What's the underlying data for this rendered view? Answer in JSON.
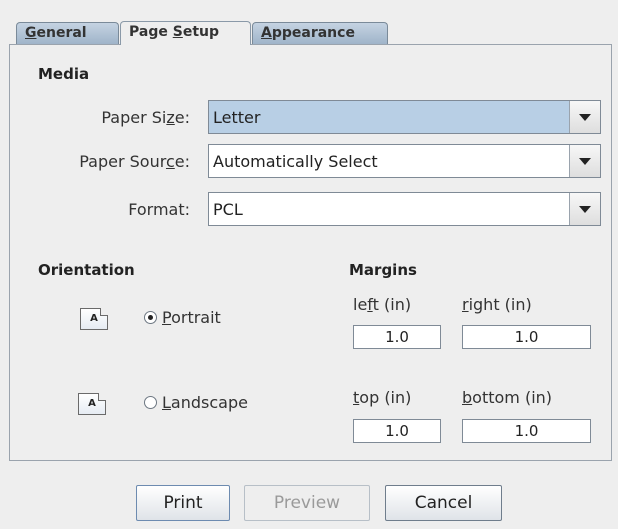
{
  "tabs": [
    {
      "label": "General",
      "mnemonic": "G",
      "rest": "eneral",
      "active": false
    },
    {
      "label": "Page Setup",
      "pre": "Page ",
      "mnemonic": "S",
      "rest": "etup",
      "active": true
    },
    {
      "label": "Appearance",
      "mnemonic": "A",
      "rest": "ppearance",
      "active": false
    }
  ],
  "media": {
    "title": "Media",
    "paper_size": {
      "label_pre": "Paper Si",
      "label_mn": "z",
      "label_post": "e:",
      "value": "Letter"
    },
    "paper_source": {
      "label_pre": "Paper Sour",
      "label_mn": "c",
      "label_post": "e:",
      "value": "Automatically Select"
    },
    "format": {
      "label": "Format:",
      "value": "PCL"
    }
  },
  "orientation": {
    "title": "Orientation",
    "icon_text": "A",
    "portrait": {
      "mn": "P",
      "rest": "ortrait",
      "selected": true
    },
    "landscape": {
      "mn": "L",
      "rest": "andscape",
      "selected": false
    }
  },
  "margins": {
    "title": "Margins",
    "left": {
      "pre": "le",
      "mn": "f",
      "post": "t (in)",
      "value": "1.0"
    },
    "right": {
      "pre": "",
      "mn": "r",
      "post": "ight (in)",
      "value": "1.0"
    },
    "top": {
      "pre": "",
      "mn": "t",
      "post": "op (in)",
      "value": "1.0"
    },
    "bottom": {
      "pre": "",
      "mn": "b",
      "post": "ottom (in)",
      "value": "1.0"
    }
  },
  "buttons": {
    "print": "Print",
    "preview": "Preview",
    "cancel": "Cancel"
  }
}
